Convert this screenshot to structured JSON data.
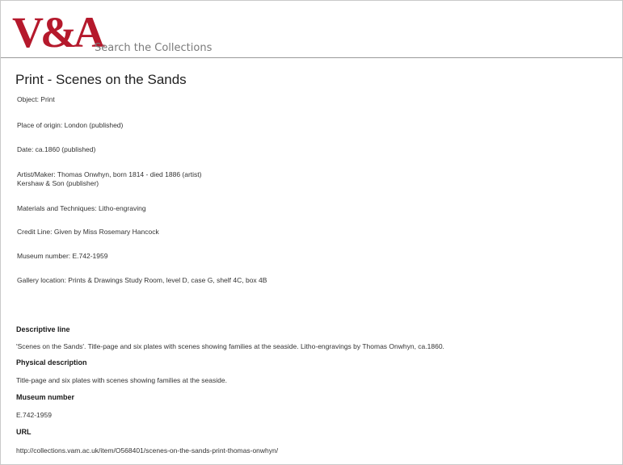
{
  "header": {
    "logo": "V&A",
    "tagline": "Search the Collections"
  },
  "record": {
    "title": "Print - Scenes on the Sands",
    "object": "Object: Print",
    "place_of_origin": "Place of origin: London (published)",
    "date": "Date: ca.1860 (published)",
    "artist_maker_line1": "Artist/Maker: Thomas Onwhyn, born 1814 - died 1886 (artist)",
    "artist_maker_line2": "Kershaw & Son (publisher)",
    "materials": "Materials and Techniques: Litho-engraving",
    "credit_line": "Credit Line: Given by Miss Rosemary Hancock",
    "museum_number": "Museum number: E.742-1959",
    "gallery_location": "Gallery location: Prints & Drawings Study Room, level D, case G, shelf 4C, box 4B"
  },
  "sections": {
    "descriptive_line_heading": "Descriptive line",
    "descriptive_line_text": "'Scenes on the Sands'.  Title-page and six plates with scenes showing families at the seaside.  Litho-engravings by Thomas Onwhyn, ca.1860.",
    "physical_description_heading": "Physical description",
    "physical_description_text": "Title-page and six plates with scenes showing families at the seaside.",
    "museum_number_heading": "Museum number",
    "museum_number_text": "E.742-1959",
    "url_heading": "URL",
    "url_text": "http://collections.vam.ac.uk/item/O568401/scenes-on-the-sands-print-thomas-onwhyn/"
  },
  "colors": {
    "brand": "#b5192c"
  }
}
